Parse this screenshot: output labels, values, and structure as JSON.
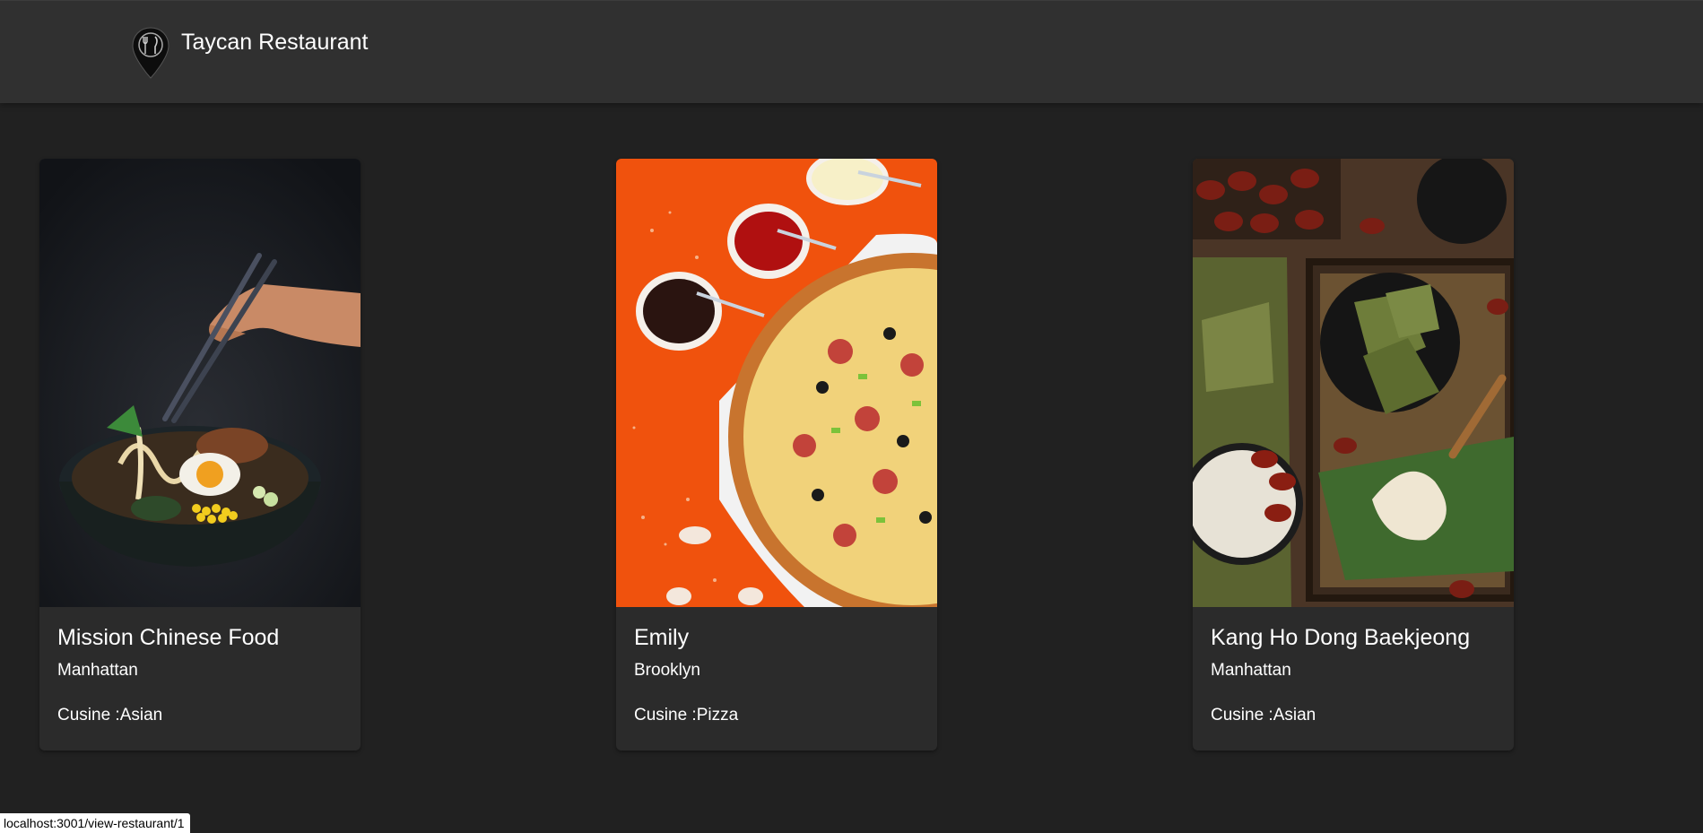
{
  "navbar": {
    "title": "Taycan Restaurant",
    "logo_icon": "location-pin-utensils-icon"
  },
  "restaurants": [
    {
      "name": "Mission Chinese Food",
      "neighborhood": "Manhattan",
      "cuisine_label": "Cusine :",
      "cuisine": "Asian",
      "image": "ramen-bowl-photo"
    },
    {
      "name": "Emily",
      "neighborhood": "Brooklyn",
      "cuisine_label": "Cusine :",
      "cuisine": "Pizza",
      "image": "pizza-photo"
    },
    {
      "name": "Kang Ho Dong Baekjeong",
      "neighborhood": "Manhattan",
      "cuisine_label": "Cusine :",
      "cuisine": "Asian",
      "image": "zongzi-photo"
    }
  ],
  "status_bar": {
    "url": "localhost:3001/view-restaurant/1"
  },
  "colors": {
    "background": "#212121",
    "navbar": "#303030",
    "card": "#2b2b2b",
    "text": "#ffffff"
  }
}
